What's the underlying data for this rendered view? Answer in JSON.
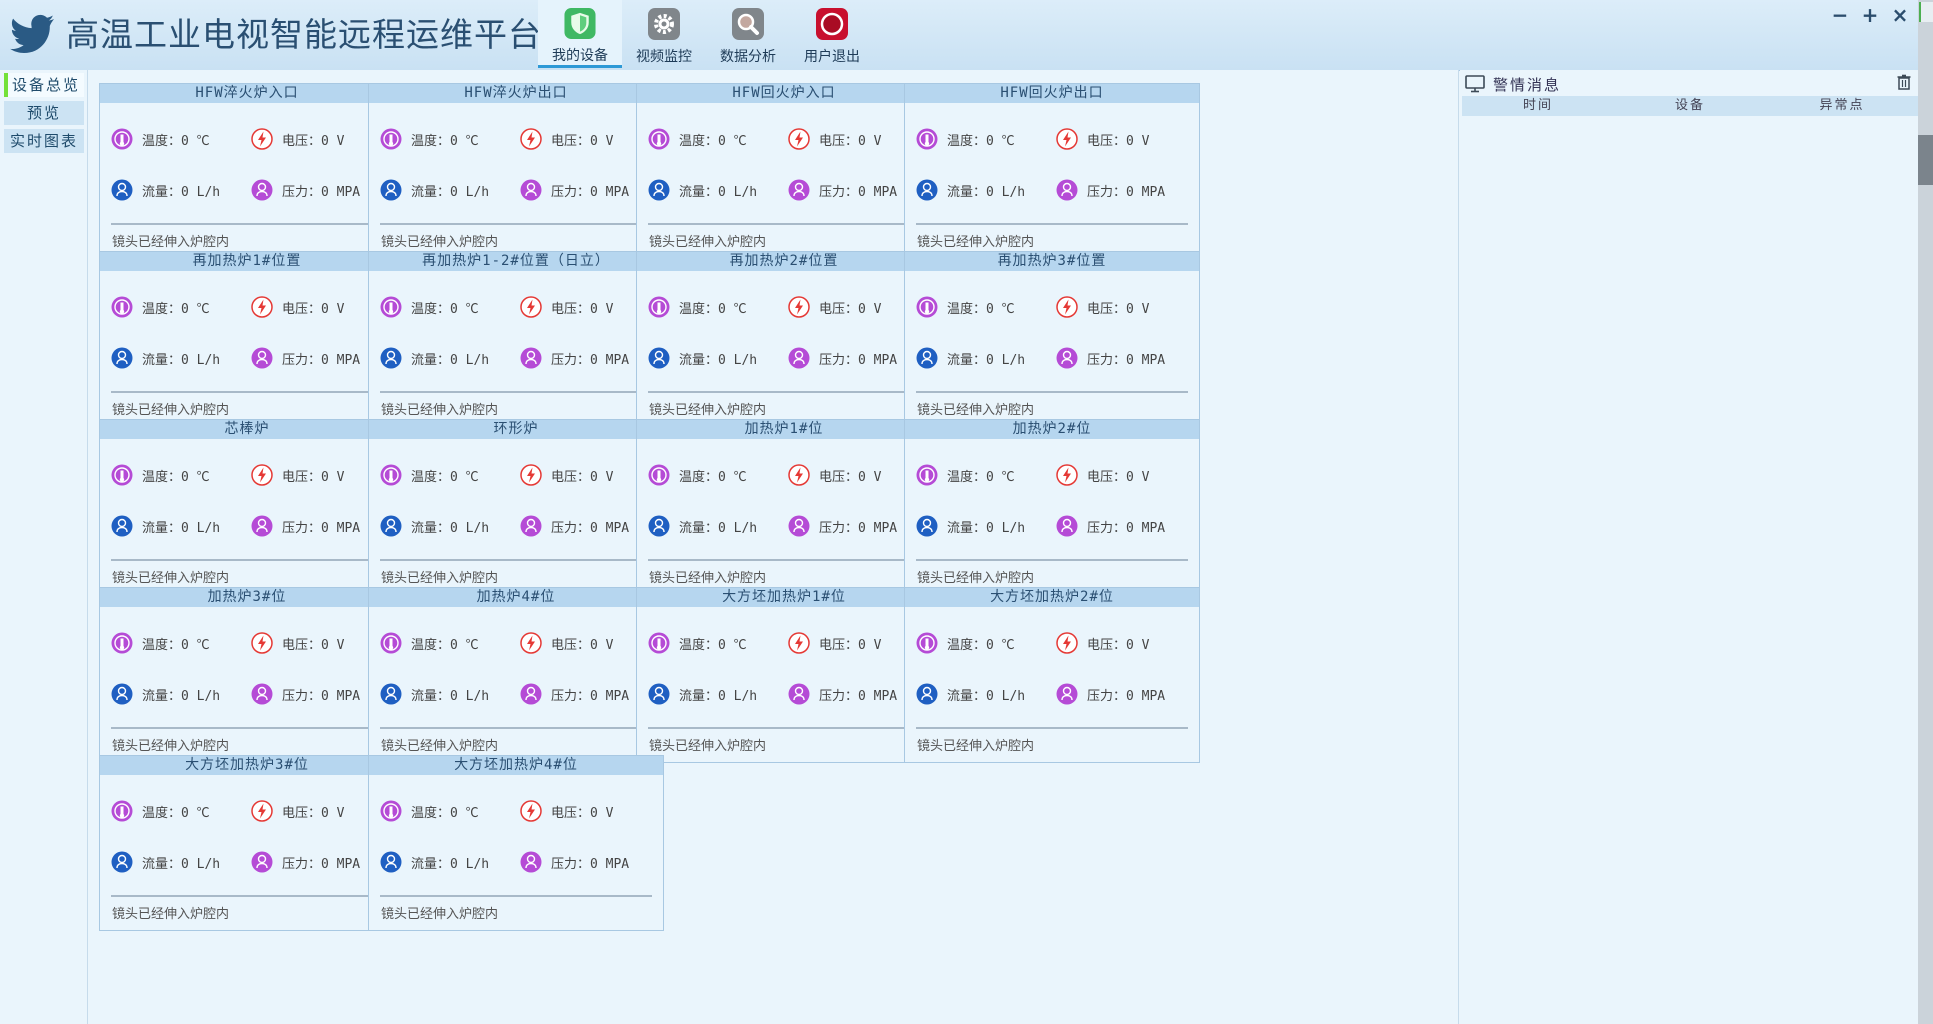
{
  "header": {
    "title": "高温工业电视智能远程运维平台",
    "nav": [
      {
        "label": "我的设备",
        "icon": "shield-icon",
        "active": true,
        "color": "#35b55a"
      },
      {
        "label": "视频监控",
        "icon": "gear-icon",
        "active": false,
        "color": "#7a7f84"
      },
      {
        "label": "数据分析",
        "icon": "magnifier-icon",
        "active": false,
        "color": "#7a7f84"
      },
      {
        "label": "用户退出",
        "icon": "power-icon",
        "active": false,
        "color": "#c8102e"
      }
    ],
    "window_controls": {
      "minimize": "−",
      "maximize": "+",
      "close": "×"
    }
  },
  "sidebar": {
    "items": [
      {
        "label": "设备总览",
        "active": true
      },
      {
        "label": "预览",
        "active": false
      },
      {
        "label": "实时图表",
        "active": false
      }
    ]
  },
  "devices": [
    {
      "name": "HFW淬火炉入口",
      "temp": "温度：0 ℃",
      "volt": "电压：0 V",
      "flow": "流量：0 L/h",
      "pres": "压力：0 MPA",
      "status": "镜头已经伸入炉腔内"
    },
    {
      "name": "HFW淬火炉出口",
      "temp": "温度：0 ℃",
      "volt": "电压：0 V",
      "flow": "流量：0 L/h",
      "pres": "压力：0 MPA",
      "status": "镜头已经伸入炉腔内"
    },
    {
      "name": "HFW回火炉入口",
      "temp": "温度：0 ℃",
      "volt": "电压：0 V",
      "flow": "流量：0 L/h",
      "pres": "压力：0 MPA",
      "status": "镜头已经伸入炉腔内"
    },
    {
      "name": "HFW回火炉出口",
      "temp": "温度：0 ℃",
      "volt": "电压：0 V",
      "flow": "流量：0 L/h",
      "pres": "压力：0 MPA",
      "status": "镜头已经伸入炉腔内"
    },
    {
      "name": "再加热炉1#位置",
      "temp": "温度：0 ℃",
      "volt": "电压：0 V",
      "flow": "流量：0 L/h",
      "pres": "压力：0 MPA",
      "status": "镜头已经伸入炉腔内"
    },
    {
      "name": "再加热炉1-2#位置（日立）",
      "temp": "温度：0 ℃",
      "volt": "电压：0 V",
      "flow": "流量：0 L/h",
      "pres": "压力：0 MPA",
      "status": "镜头已经伸入炉腔内"
    },
    {
      "name": "再加热炉2#位置",
      "temp": "温度：0 ℃",
      "volt": "电压：0 V",
      "flow": "流量：0 L/h",
      "pres": "压力：0 MPA",
      "status": "镜头已经伸入炉腔内"
    },
    {
      "name": "再加热炉3#位置",
      "temp": "温度：0 ℃",
      "volt": "电压：0 V",
      "flow": "流量：0 L/h",
      "pres": "压力：0 MPA",
      "status": "镜头已经伸入炉腔内"
    },
    {
      "name": "芯棒炉",
      "temp": "温度：0 ℃",
      "volt": "电压：0 V",
      "flow": "流量：0 L/h",
      "pres": "压力：0 MPA",
      "status": "镜头已经伸入炉腔内"
    },
    {
      "name": "环形炉",
      "temp": "温度：0 ℃",
      "volt": "电压：0 V",
      "flow": "流量：0 L/h",
      "pres": "压力：0 MPA",
      "status": "镜头已经伸入炉腔内"
    },
    {
      "name": "加热炉1#位",
      "temp": "温度：0 ℃",
      "volt": "电压：0 V",
      "flow": "流量：0 L/h",
      "pres": "压力：0 MPA",
      "status": "镜头已经伸入炉腔内"
    },
    {
      "name": "加热炉2#位",
      "temp": "温度：0 ℃",
      "volt": "电压：0 V",
      "flow": "流量：0 L/h",
      "pres": "压力：0 MPA",
      "status": "镜头已经伸入炉腔内"
    },
    {
      "name": "加热炉3#位",
      "temp": "温度：0 ℃",
      "volt": "电压：0 V",
      "flow": "流量：0 L/h",
      "pres": "压力：0 MPA",
      "status": "镜头已经伸入炉腔内"
    },
    {
      "name": "加热炉4#位",
      "temp": "温度：0 ℃",
      "volt": "电压：0 V",
      "flow": "流量：0 L/h",
      "pres": "压力：0 MPA",
      "status": "镜头已经伸入炉腔内"
    },
    {
      "name": "大方坯加热炉1#位",
      "temp": "温度：0 ℃",
      "volt": "电压：0 V",
      "flow": "流量：0 L/h",
      "pres": "压力：0 MPA",
      "status": "镜头已经伸入炉腔内"
    },
    {
      "name": "大方坯加热炉2#位",
      "temp": "温度：0 ℃",
      "volt": "电压：0 V",
      "flow": "流量：0 L/h",
      "pres": "压力：0 MPA",
      "status": "镜头已经伸入炉腔内"
    },
    {
      "name": "大方坯加热炉3#位",
      "temp": "温度：0 ℃",
      "volt": "电压：0 V",
      "flow": "流量：0 L/h",
      "pres": "压力：0 MPA",
      "status": "镜头已经伸入炉腔内"
    },
    {
      "name": "大方坯加热炉4#位",
      "temp": "温度：0 ℃",
      "volt": "电压：0 V",
      "flow": "流量：0 L/h",
      "pres": "压力：0 MPA",
      "status": "镜头已经伸入炉腔内"
    }
  ],
  "alerts": {
    "title": "警情消息",
    "columns": [
      "时间",
      "设备",
      "异常点"
    ],
    "rows": []
  },
  "colors": {
    "accent": "#2d99d6",
    "temp_icon": "#b54bd6",
    "volt_icon": "#e53935",
    "flow_icon": "#1f5fc2",
    "pressure_icon": "#b54bd6",
    "active_marker": "#73e13a"
  }
}
